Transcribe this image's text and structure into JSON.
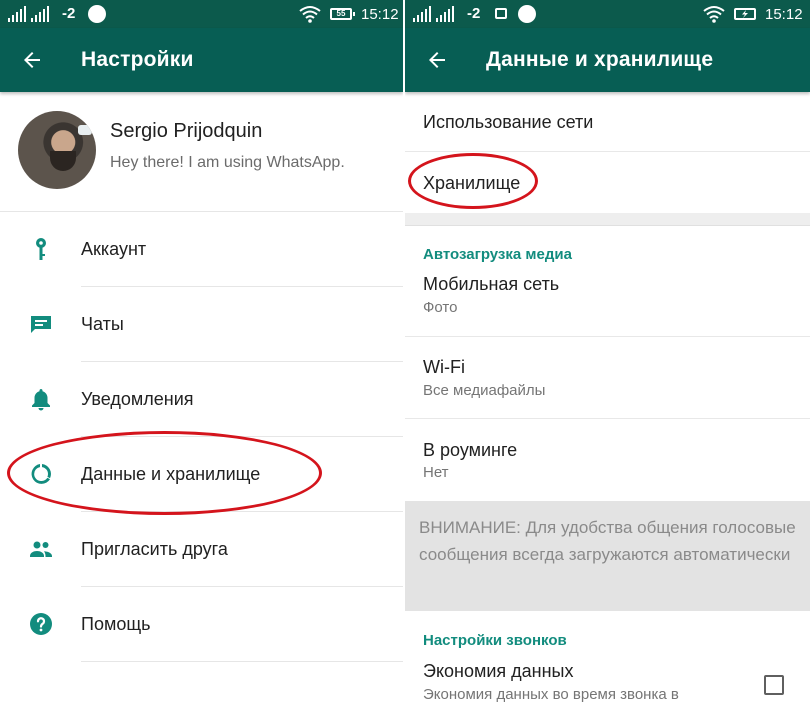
{
  "colors": {
    "statusbar": "#0c5a4c",
    "toolbar": "#075e54",
    "accent": "#128c7e",
    "annotation": "#d4141c"
  },
  "left": {
    "status": {
      "network": "-2",
      "time": "15:12",
      "battery": "55"
    },
    "toolbar": {
      "back_icon": "arrow-left-icon",
      "title": "Настройки"
    },
    "profile": {
      "name": "Sergio Prijodquin",
      "status": "Hey there! I am using WhatsApp."
    },
    "menu": [
      {
        "icon": "key-icon",
        "label": "Аккаунт"
      },
      {
        "icon": "chat-icon",
        "label": "Чаты"
      },
      {
        "icon": "bell-icon",
        "label": "Уведомления"
      },
      {
        "icon": "data-usage-icon",
        "label": "Данные и хранилище",
        "highlighted": true
      },
      {
        "icon": "people-icon",
        "label": "Пригласить друга"
      },
      {
        "icon": "help-icon",
        "label": "Помощь"
      }
    ]
  },
  "right": {
    "status": {
      "network": "-2",
      "time": "15:12"
    },
    "toolbar": {
      "back_icon": "arrow-left-icon",
      "title": "Данные и хранилище"
    },
    "items": [
      {
        "title": "Использование сети"
      },
      {
        "title": "Хранилище",
        "highlighted": true
      }
    ],
    "autodownload": {
      "header": "Автозагрузка медиа",
      "items": [
        {
          "title": "Мобильная сеть",
          "subtitle": "Фото"
        },
        {
          "title": "Wi-Fi",
          "subtitle": "Все медиафайлы"
        },
        {
          "title": "В роуминге",
          "subtitle": "Нет"
        }
      ],
      "notice": "ВНИМАНИЕ: Для удобства общения голосовые сообщения всегда загружаются автоматически"
    },
    "calls": {
      "header": "Настройки звонков",
      "item": {
        "title": "Экономия данных",
        "subtitle": "Экономия данных во время звонка в",
        "checked": false
      }
    }
  }
}
